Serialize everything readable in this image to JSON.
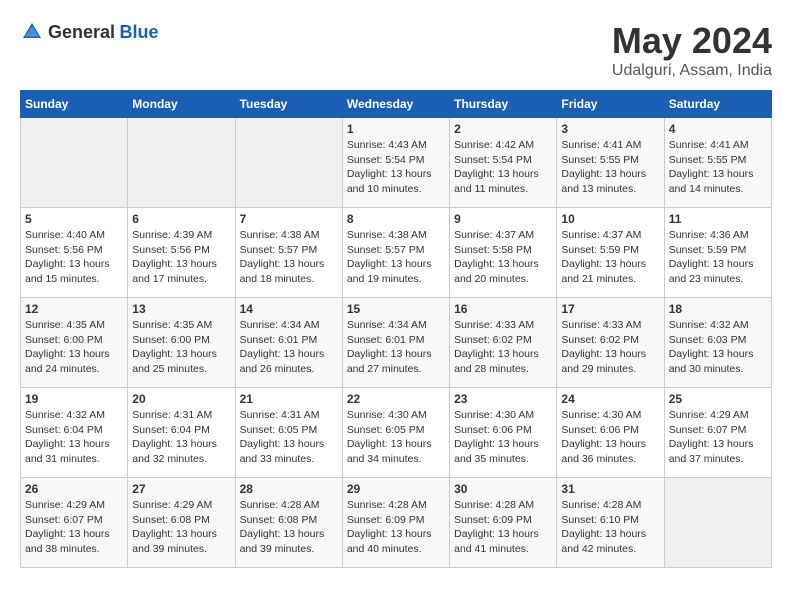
{
  "header": {
    "logo_general": "General",
    "logo_blue": "Blue",
    "month_year": "May 2024",
    "location": "Udalguri, Assam, India"
  },
  "weekdays": [
    "Sunday",
    "Monday",
    "Tuesday",
    "Wednesday",
    "Thursday",
    "Friday",
    "Saturday"
  ],
  "weeks": [
    [
      {
        "day": "",
        "info": ""
      },
      {
        "day": "",
        "info": ""
      },
      {
        "day": "",
        "info": ""
      },
      {
        "day": "1",
        "info": "Sunrise: 4:43 AM\nSunset: 5:54 PM\nDaylight: 13 hours\nand 10 minutes."
      },
      {
        "day": "2",
        "info": "Sunrise: 4:42 AM\nSunset: 5:54 PM\nDaylight: 13 hours\nand 11 minutes."
      },
      {
        "day": "3",
        "info": "Sunrise: 4:41 AM\nSunset: 5:55 PM\nDaylight: 13 hours\nand 13 minutes."
      },
      {
        "day": "4",
        "info": "Sunrise: 4:41 AM\nSunset: 5:55 PM\nDaylight: 13 hours\nand 14 minutes."
      }
    ],
    [
      {
        "day": "5",
        "info": "Sunrise: 4:40 AM\nSunset: 5:56 PM\nDaylight: 13 hours\nand 15 minutes."
      },
      {
        "day": "6",
        "info": "Sunrise: 4:39 AM\nSunset: 5:56 PM\nDaylight: 13 hours\nand 17 minutes."
      },
      {
        "day": "7",
        "info": "Sunrise: 4:38 AM\nSunset: 5:57 PM\nDaylight: 13 hours\nand 18 minutes."
      },
      {
        "day": "8",
        "info": "Sunrise: 4:38 AM\nSunset: 5:57 PM\nDaylight: 13 hours\nand 19 minutes."
      },
      {
        "day": "9",
        "info": "Sunrise: 4:37 AM\nSunset: 5:58 PM\nDaylight: 13 hours\nand 20 minutes."
      },
      {
        "day": "10",
        "info": "Sunrise: 4:37 AM\nSunset: 5:59 PM\nDaylight: 13 hours\nand 21 minutes."
      },
      {
        "day": "11",
        "info": "Sunrise: 4:36 AM\nSunset: 5:59 PM\nDaylight: 13 hours\nand 23 minutes."
      }
    ],
    [
      {
        "day": "12",
        "info": "Sunrise: 4:35 AM\nSunset: 6:00 PM\nDaylight: 13 hours\nand 24 minutes."
      },
      {
        "day": "13",
        "info": "Sunrise: 4:35 AM\nSunset: 6:00 PM\nDaylight: 13 hours\nand 25 minutes."
      },
      {
        "day": "14",
        "info": "Sunrise: 4:34 AM\nSunset: 6:01 PM\nDaylight: 13 hours\nand 26 minutes."
      },
      {
        "day": "15",
        "info": "Sunrise: 4:34 AM\nSunset: 6:01 PM\nDaylight: 13 hours\nand 27 minutes."
      },
      {
        "day": "16",
        "info": "Sunrise: 4:33 AM\nSunset: 6:02 PM\nDaylight: 13 hours\nand 28 minutes."
      },
      {
        "day": "17",
        "info": "Sunrise: 4:33 AM\nSunset: 6:02 PM\nDaylight: 13 hours\nand 29 minutes."
      },
      {
        "day": "18",
        "info": "Sunrise: 4:32 AM\nSunset: 6:03 PM\nDaylight: 13 hours\nand 30 minutes."
      }
    ],
    [
      {
        "day": "19",
        "info": "Sunrise: 4:32 AM\nSunset: 6:04 PM\nDaylight: 13 hours\nand 31 minutes."
      },
      {
        "day": "20",
        "info": "Sunrise: 4:31 AM\nSunset: 6:04 PM\nDaylight: 13 hours\nand 32 minutes."
      },
      {
        "day": "21",
        "info": "Sunrise: 4:31 AM\nSunset: 6:05 PM\nDaylight: 13 hours\nand 33 minutes."
      },
      {
        "day": "22",
        "info": "Sunrise: 4:30 AM\nSunset: 6:05 PM\nDaylight: 13 hours\nand 34 minutes."
      },
      {
        "day": "23",
        "info": "Sunrise: 4:30 AM\nSunset: 6:06 PM\nDaylight: 13 hours\nand 35 minutes."
      },
      {
        "day": "24",
        "info": "Sunrise: 4:30 AM\nSunset: 6:06 PM\nDaylight: 13 hours\nand 36 minutes."
      },
      {
        "day": "25",
        "info": "Sunrise: 4:29 AM\nSunset: 6:07 PM\nDaylight: 13 hours\nand 37 minutes."
      }
    ],
    [
      {
        "day": "26",
        "info": "Sunrise: 4:29 AM\nSunset: 6:07 PM\nDaylight: 13 hours\nand 38 minutes."
      },
      {
        "day": "27",
        "info": "Sunrise: 4:29 AM\nSunset: 6:08 PM\nDaylight: 13 hours\nand 39 minutes."
      },
      {
        "day": "28",
        "info": "Sunrise: 4:28 AM\nSunset: 6:08 PM\nDaylight: 13 hours\nand 39 minutes."
      },
      {
        "day": "29",
        "info": "Sunrise: 4:28 AM\nSunset: 6:09 PM\nDaylight: 13 hours\nand 40 minutes."
      },
      {
        "day": "30",
        "info": "Sunrise: 4:28 AM\nSunset: 6:09 PM\nDaylight: 13 hours\nand 41 minutes."
      },
      {
        "day": "31",
        "info": "Sunrise: 4:28 AM\nSunset: 6:10 PM\nDaylight: 13 hours\nand 42 minutes."
      },
      {
        "day": "",
        "info": ""
      }
    ]
  ]
}
